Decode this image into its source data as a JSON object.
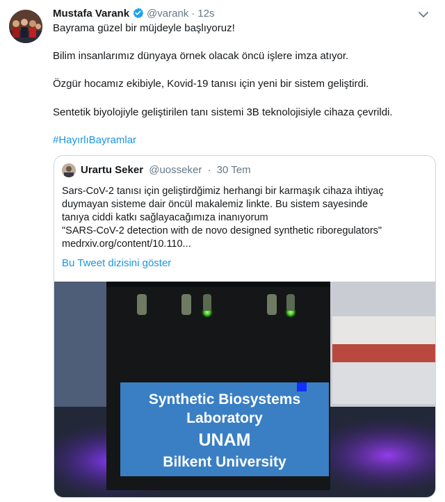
{
  "tweet": {
    "author_name": "Mustafa Varank",
    "handle": "@varank",
    "time": "12s",
    "lines": [
      "Bayrama güzel bir müjdeyle başlıyoruz!",
      "Bilim insanlarımız dünyaya örnek olacak öncü işlere imza atıyor.",
      "Özgür hocamız ekibiyle, Kovid-19 tanısı için yeni bir sistem geliştirdi.",
      "Sentetik biyolojiyle geliştirilen tanı sistemi 3B teknolojisiyle cihaza çevrildi."
    ],
    "hashtag": "#HayırlıBayramlar"
  },
  "quoted": {
    "author_name": "Urartu Seker",
    "handle": "@uosseker",
    "date": "30 Tem",
    "text": "Sars-CoV-2 tanısı için geliştirdğimiz herhangi bir karmaşık cihaza ihtiyaç\nduymayan sisteme dair öncül makalemiz linkte. Bu sistem sayesinde\ntanıya ciddi katkı sağlayacağımıza inanıyorum\n\"SARS-CoV-2 detection with de novo designed synthetic riboregulators\"\nmedrxiv.org/content/10.110...",
    "show_thread": "Bu Tweet dizisini göster",
    "photo_label": [
      "Synthetic Biosystems",
      "Laboratory",
      "UNAM",
      "Bilkent University"
    ]
  },
  "colors": {
    "link": "#1b95e0",
    "verified": "#1da1f2",
    "muted": "#657786",
    "border": "#ccd6dd"
  },
  "icons": [
    "verified-badge-icon",
    "chevron-down-icon"
  ]
}
